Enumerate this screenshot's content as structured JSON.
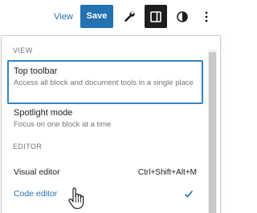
{
  "toolbar": {
    "view_label": "View",
    "save_label": "Save",
    "wrench_icon": "tools-icon",
    "settings_icon": "sidebar-settings-icon",
    "styles_icon": "half-circle-styles-icon",
    "options_icon": "vertical-ellipsis-icon",
    "accent_color": "#2271b1"
  },
  "menu": {
    "view_section": {
      "heading": "VIEW",
      "items": [
        {
          "title": "Top toolbar",
          "description": "Access all block and document tools in a single place"
        },
        {
          "title": "Spotlight mode",
          "description": "Focus on one block at a time"
        }
      ]
    },
    "editor_section": {
      "heading": "EDITOR",
      "items": [
        {
          "label": "Visual editor",
          "shortcut": "Ctrl+Shift+Alt+M"
        },
        {
          "label": "Code editor",
          "checked": true
        }
      ]
    }
  }
}
